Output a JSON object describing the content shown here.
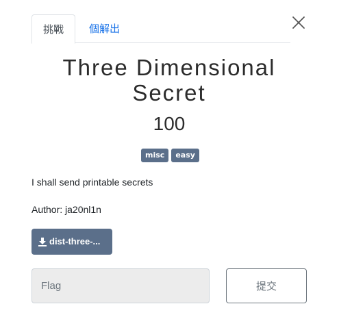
{
  "tabs": [
    {
      "label": "挑戰",
      "active": true
    },
    {
      "label": "個解出",
      "active": false
    }
  ],
  "challenge": {
    "name": "Three Dimensional Secret",
    "value": "100",
    "tags": [
      "misc",
      "easy"
    ],
    "description": "I shall send printable secrets",
    "author": "Author: ja20nl1n",
    "file_label": "dist-three-..."
  },
  "form": {
    "flag_placeholder": "Flag",
    "submit_label": "提交"
  },
  "colors": {
    "tag_bg": "#5b6f8a",
    "link": "#1a73e8",
    "input_bg": "#ececec"
  },
  "icons": {
    "close": "close-icon",
    "download": "download-icon"
  }
}
